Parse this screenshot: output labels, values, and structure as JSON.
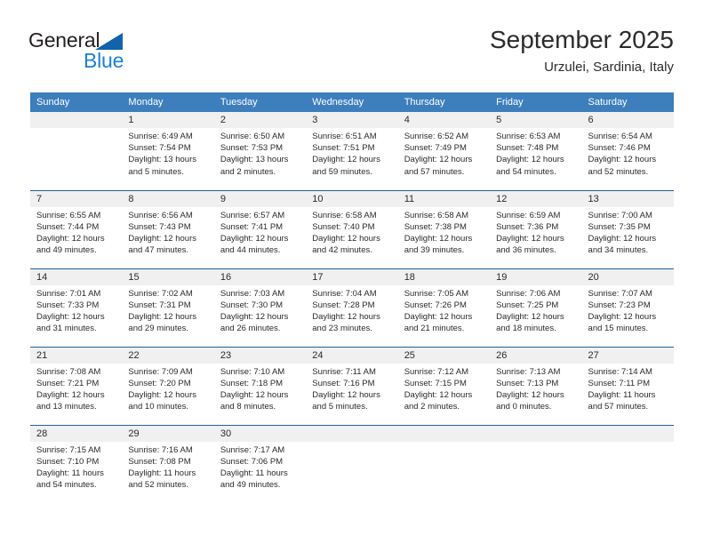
{
  "brand": {
    "name_part1": "General",
    "name_part2": "Blue",
    "triangle_icon": "triangle-icon",
    "colors": {
      "general": "#231f20",
      "blue": "#1a81d6",
      "triangle": "#1263ab"
    }
  },
  "header": {
    "title": "September 2025",
    "subtitle": "Urzulei, Sardinia, Italy"
  },
  "theme": {
    "header_bg": "#3d7ebd",
    "header_text": "#ffffff",
    "row_separator": "#1f5fa0",
    "daynum_band": "#f0f0f0",
    "body_text": "#2a2a2a"
  },
  "calendar": {
    "weekday_headers": [
      "Sunday",
      "Monday",
      "Tuesday",
      "Wednesday",
      "Thursday",
      "Friday",
      "Saturday"
    ],
    "weeks": [
      [
        {
          "day": "",
          "lines": []
        },
        {
          "day": "1",
          "lines": [
            "Sunrise: 6:49 AM",
            "Sunset: 7:54 PM",
            "Daylight: 13 hours",
            "and 5 minutes."
          ]
        },
        {
          "day": "2",
          "lines": [
            "Sunrise: 6:50 AM",
            "Sunset: 7:53 PM",
            "Daylight: 13 hours",
            "and 2 minutes."
          ]
        },
        {
          "day": "3",
          "lines": [
            "Sunrise: 6:51 AM",
            "Sunset: 7:51 PM",
            "Daylight: 12 hours",
            "and 59 minutes."
          ]
        },
        {
          "day": "4",
          "lines": [
            "Sunrise: 6:52 AM",
            "Sunset: 7:49 PM",
            "Daylight: 12 hours",
            "and 57 minutes."
          ]
        },
        {
          "day": "5",
          "lines": [
            "Sunrise: 6:53 AM",
            "Sunset: 7:48 PM",
            "Daylight: 12 hours",
            "and 54 minutes."
          ]
        },
        {
          "day": "6",
          "lines": [
            "Sunrise: 6:54 AM",
            "Sunset: 7:46 PM",
            "Daylight: 12 hours",
            "and 52 minutes."
          ]
        }
      ],
      [
        {
          "day": "7",
          "lines": [
            "Sunrise: 6:55 AM",
            "Sunset: 7:44 PM",
            "Daylight: 12 hours",
            "and 49 minutes."
          ]
        },
        {
          "day": "8",
          "lines": [
            "Sunrise: 6:56 AM",
            "Sunset: 7:43 PM",
            "Daylight: 12 hours",
            "and 47 minutes."
          ]
        },
        {
          "day": "9",
          "lines": [
            "Sunrise: 6:57 AM",
            "Sunset: 7:41 PM",
            "Daylight: 12 hours",
            "and 44 minutes."
          ]
        },
        {
          "day": "10",
          "lines": [
            "Sunrise: 6:58 AM",
            "Sunset: 7:40 PM",
            "Daylight: 12 hours",
            "and 42 minutes."
          ]
        },
        {
          "day": "11",
          "lines": [
            "Sunrise: 6:58 AM",
            "Sunset: 7:38 PM",
            "Daylight: 12 hours",
            "and 39 minutes."
          ]
        },
        {
          "day": "12",
          "lines": [
            "Sunrise: 6:59 AM",
            "Sunset: 7:36 PM",
            "Daylight: 12 hours",
            "and 36 minutes."
          ]
        },
        {
          "day": "13",
          "lines": [
            "Sunrise: 7:00 AM",
            "Sunset: 7:35 PM",
            "Daylight: 12 hours",
            "and 34 minutes."
          ]
        }
      ],
      [
        {
          "day": "14",
          "lines": [
            "Sunrise: 7:01 AM",
            "Sunset: 7:33 PM",
            "Daylight: 12 hours",
            "and 31 minutes."
          ]
        },
        {
          "day": "15",
          "lines": [
            "Sunrise: 7:02 AM",
            "Sunset: 7:31 PM",
            "Daylight: 12 hours",
            "and 29 minutes."
          ]
        },
        {
          "day": "16",
          "lines": [
            "Sunrise: 7:03 AM",
            "Sunset: 7:30 PM",
            "Daylight: 12 hours",
            "and 26 minutes."
          ]
        },
        {
          "day": "17",
          "lines": [
            "Sunrise: 7:04 AM",
            "Sunset: 7:28 PM",
            "Daylight: 12 hours",
            "and 23 minutes."
          ]
        },
        {
          "day": "18",
          "lines": [
            "Sunrise: 7:05 AM",
            "Sunset: 7:26 PM",
            "Daylight: 12 hours",
            "and 21 minutes."
          ]
        },
        {
          "day": "19",
          "lines": [
            "Sunrise: 7:06 AM",
            "Sunset: 7:25 PM",
            "Daylight: 12 hours",
            "and 18 minutes."
          ]
        },
        {
          "day": "20",
          "lines": [
            "Sunrise: 7:07 AM",
            "Sunset: 7:23 PM",
            "Daylight: 12 hours",
            "and 15 minutes."
          ]
        }
      ],
      [
        {
          "day": "21",
          "lines": [
            "Sunrise: 7:08 AM",
            "Sunset: 7:21 PM",
            "Daylight: 12 hours",
            "and 13 minutes."
          ]
        },
        {
          "day": "22",
          "lines": [
            "Sunrise: 7:09 AM",
            "Sunset: 7:20 PM",
            "Daylight: 12 hours",
            "and 10 minutes."
          ]
        },
        {
          "day": "23",
          "lines": [
            "Sunrise: 7:10 AM",
            "Sunset: 7:18 PM",
            "Daylight: 12 hours",
            "and 8 minutes."
          ]
        },
        {
          "day": "24",
          "lines": [
            "Sunrise: 7:11 AM",
            "Sunset: 7:16 PM",
            "Daylight: 12 hours",
            "and 5 minutes."
          ]
        },
        {
          "day": "25",
          "lines": [
            "Sunrise: 7:12 AM",
            "Sunset: 7:15 PM",
            "Daylight: 12 hours",
            "and 2 minutes."
          ]
        },
        {
          "day": "26",
          "lines": [
            "Sunrise: 7:13 AM",
            "Sunset: 7:13 PM",
            "Daylight: 12 hours",
            "and 0 minutes."
          ]
        },
        {
          "day": "27",
          "lines": [
            "Sunrise: 7:14 AM",
            "Sunset: 7:11 PM",
            "Daylight: 11 hours",
            "and 57 minutes."
          ]
        }
      ],
      [
        {
          "day": "28",
          "lines": [
            "Sunrise: 7:15 AM",
            "Sunset: 7:10 PM",
            "Daylight: 11 hours",
            "and 54 minutes."
          ]
        },
        {
          "day": "29",
          "lines": [
            "Sunrise: 7:16 AM",
            "Sunset: 7:08 PM",
            "Daylight: 11 hours",
            "and 52 minutes."
          ]
        },
        {
          "day": "30",
          "lines": [
            "Sunrise: 7:17 AM",
            "Sunset: 7:06 PM",
            "Daylight: 11 hours",
            "and 49 minutes."
          ]
        },
        {
          "day": "",
          "lines": []
        },
        {
          "day": "",
          "lines": []
        },
        {
          "day": "",
          "lines": []
        },
        {
          "day": "",
          "lines": []
        }
      ]
    ]
  }
}
